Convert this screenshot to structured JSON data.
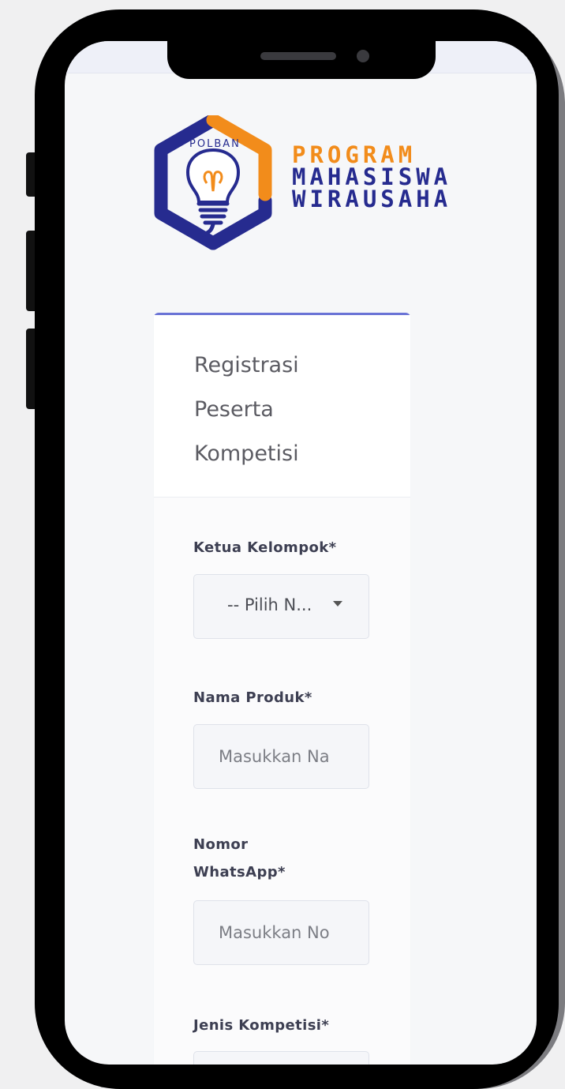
{
  "logo": {
    "badge_text": "POLBAN",
    "line1": "PROGRAM",
    "line2": "MAHASISWA",
    "line3": "WIRAUSAHA",
    "icon": "lightbulb-icon",
    "colors": {
      "orange": "#f28c1b",
      "navy": "#262b8f"
    }
  },
  "card": {
    "title_lines": [
      "Registrasi",
      "Peserta",
      "Kompetisi"
    ],
    "accent": "#6a73d6"
  },
  "form": {
    "ketua": {
      "label": "Ketua Kelompok*",
      "value": "-- Pilih N..."
    },
    "nama_produk": {
      "label": "Nama Produk*",
      "placeholder": "Masukkan Na"
    },
    "nomor_wa": {
      "label_line1": "Nomor",
      "label_line2": "WhatsApp*",
      "placeholder": "Masukkan No"
    },
    "jenis": {
      "label": "Jenis Kompetisi*"
    }
  }
}
